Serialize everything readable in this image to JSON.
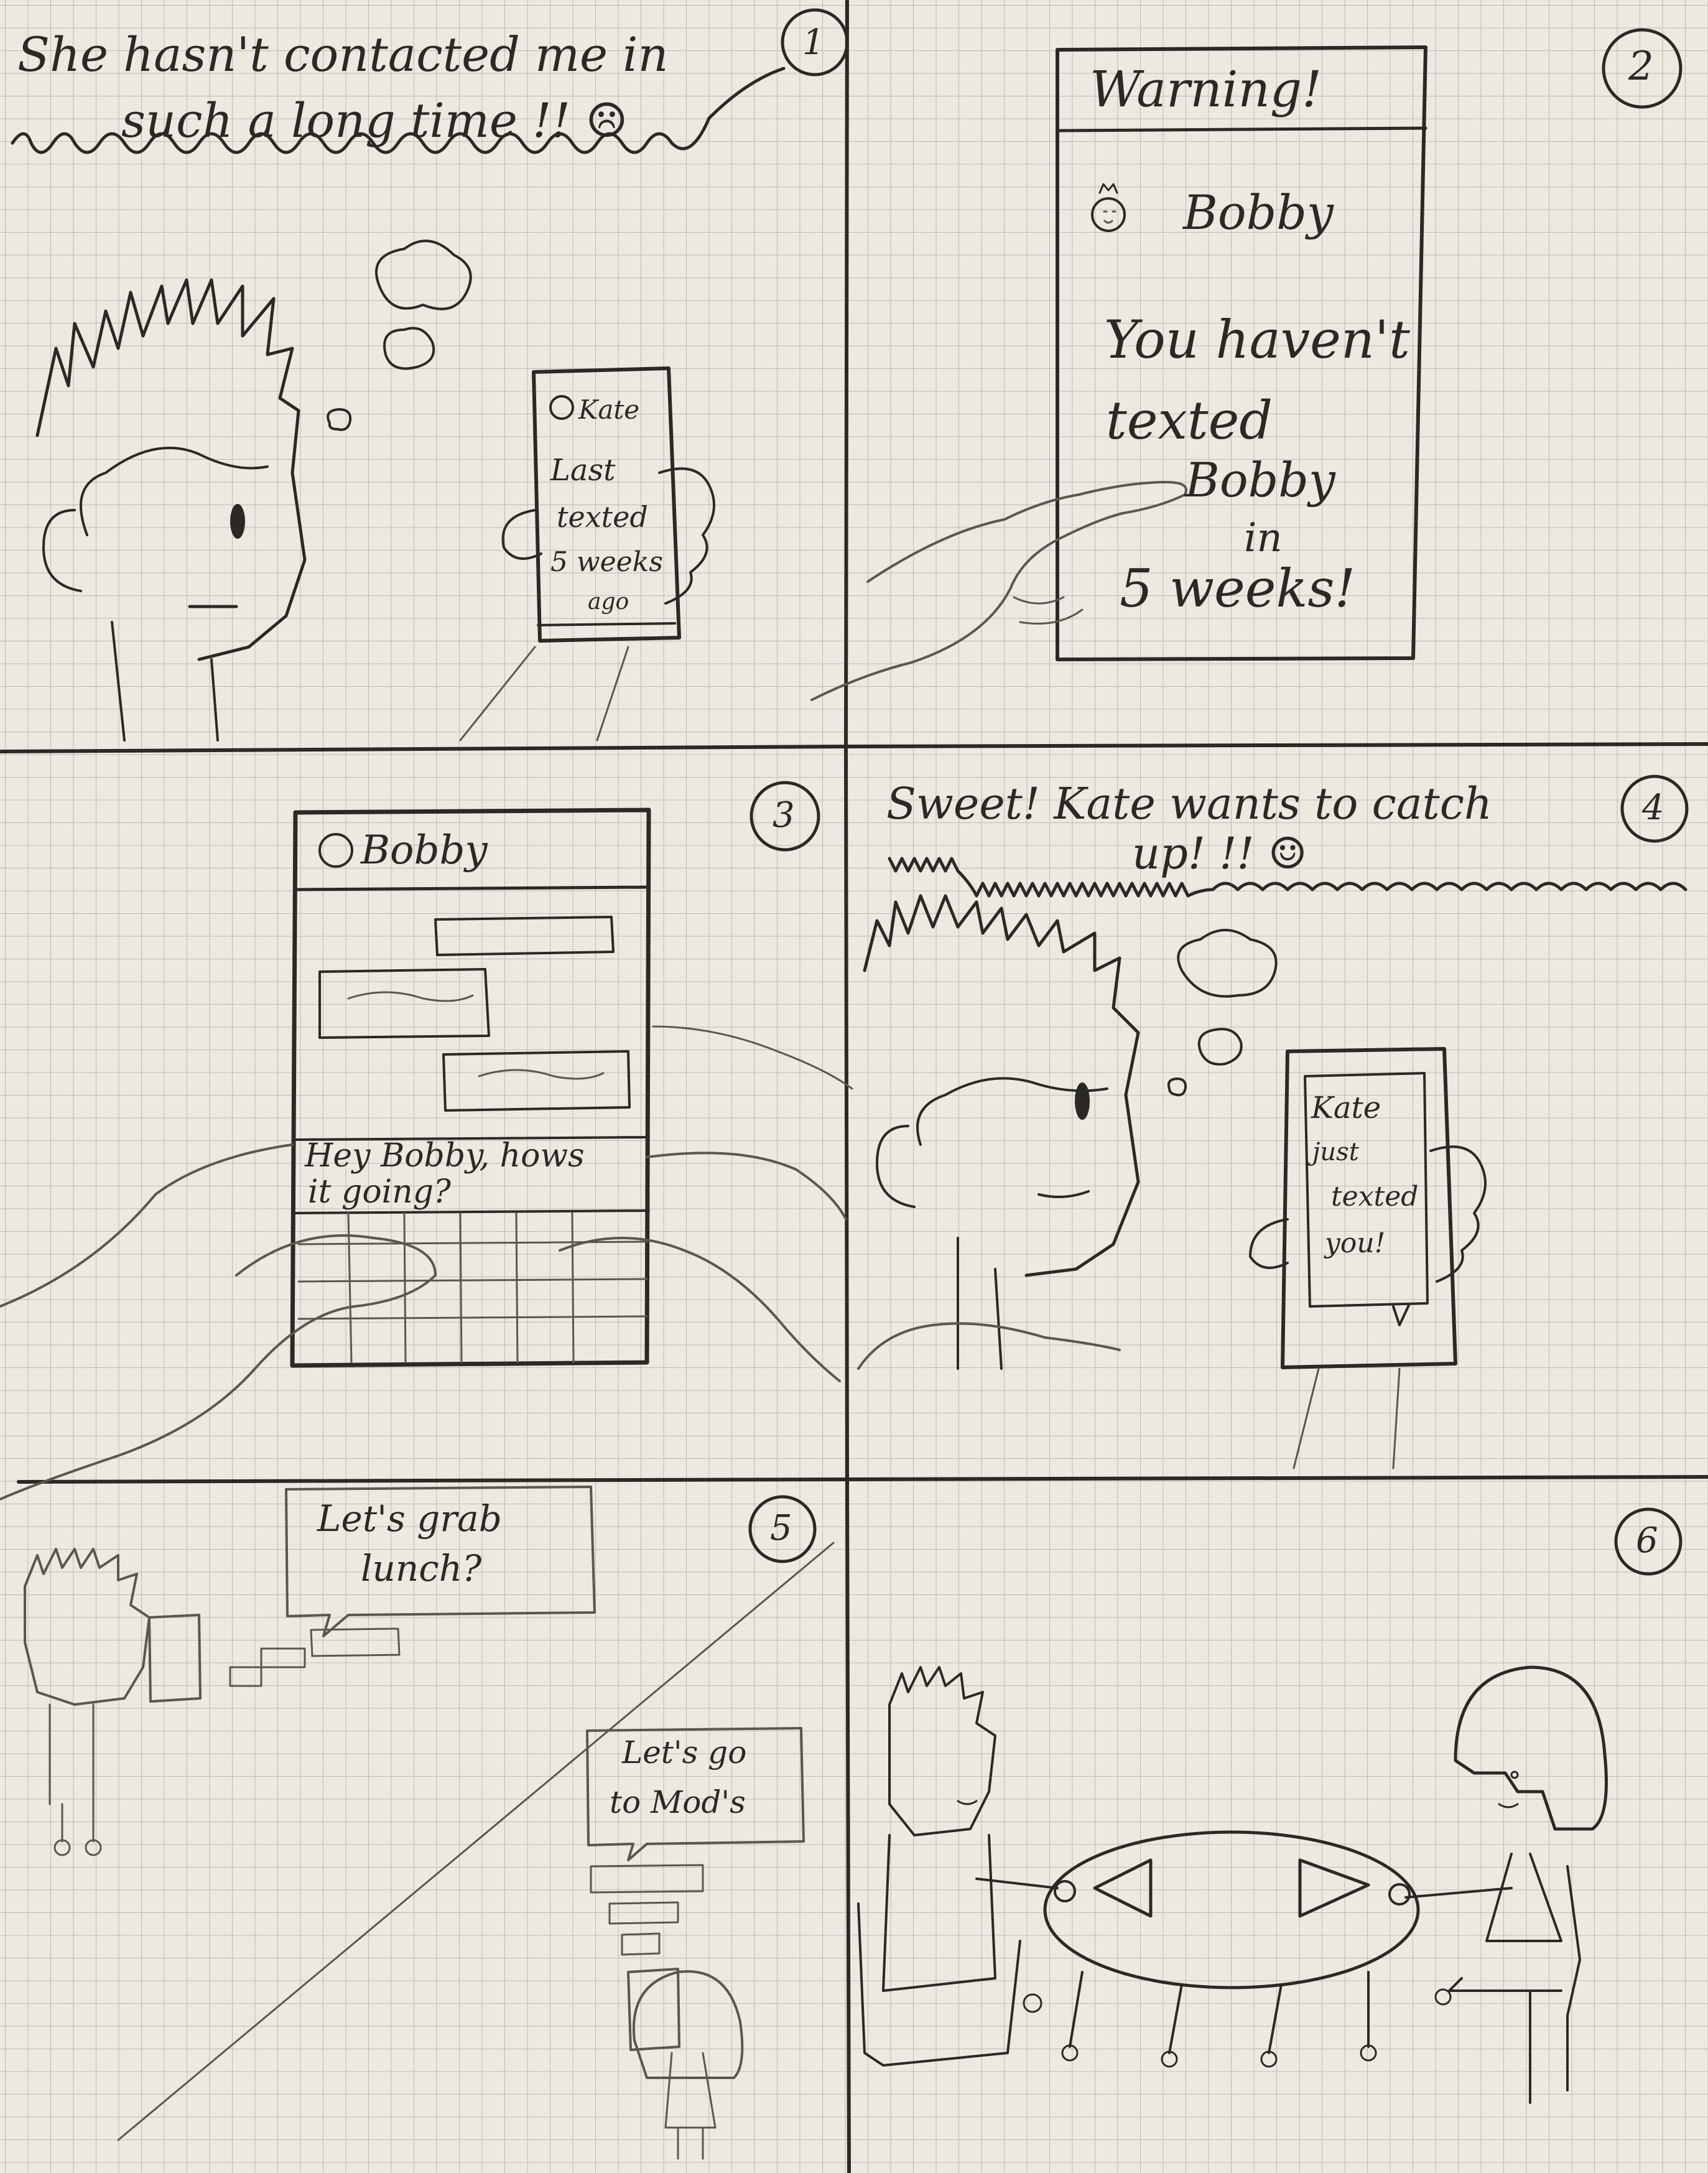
{
  "panels": [
    {
      "number": "1",
      "speech": [
        "She hasn't contacted me in",
        "such a long time !! ☹"
      ],
      "phone_name": "Kate",
      "phone_lines": [
        "Last",
        "texted",
        "5 weeks",
        "ago"
      ]
    },
    {
      "number": "2",
      "header": "Warning!",
      "contact": "Bobby",
      "message_lines": [
        "You haven't",
        "texted",
        "Bobby",
        "in",
        "5 weeks!"
      ]
    },
    {
      "number": "3",
      "contact": "Bobby",
      "typed_lines": [
        "Hey Bobby, hows",
        "it going?"
      ]
    },
    {
      "number": "4",
      "speech": [
        "Sweet! Kate wants to catch",
        "up! !! ☺"
      ],
      "phone_lines": [
        "Kate",
        "just",
        "texted",
        "you!"
      ]
    },
    {
      "number": "5",
      "bubble_top": [
        "Let's grab",
        "lunch?"
      ],
      "bubble_bottom": [
        "Let's go",
        "to Mod's"
      ]
    },
    {
      "number": "6"
    }
  ],
  "colors": {
    "paper": "#ece9e1",
    "grid": "#bdbab3",
    "ink": "#2b2926"
  }
}
